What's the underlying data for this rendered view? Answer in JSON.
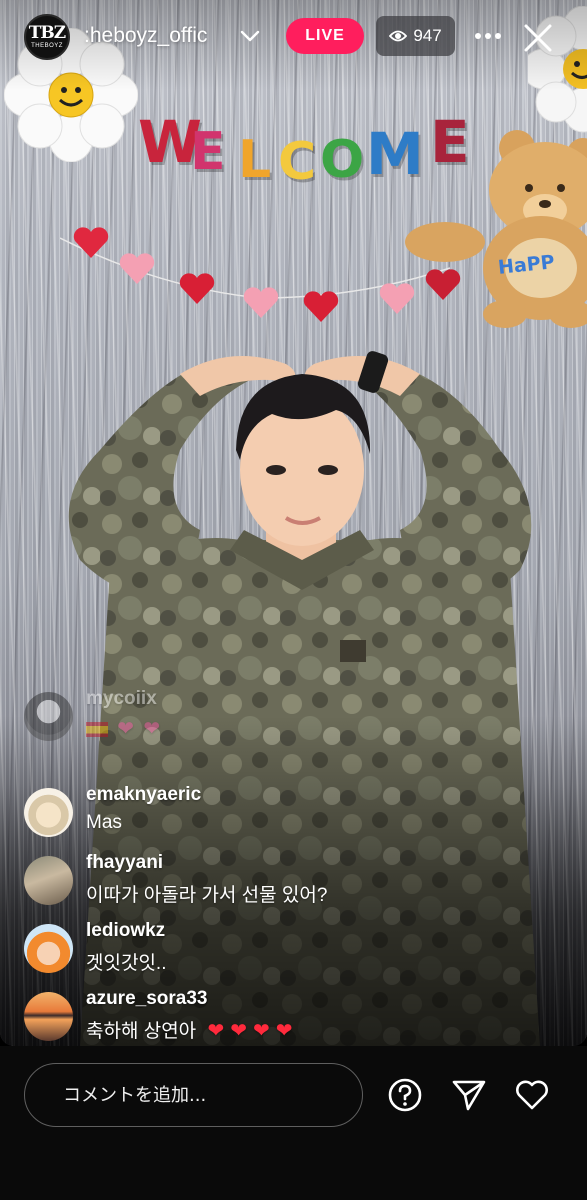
{
  "header": {
    "logo_mono": "TBZ",
    "logo_sub": "THEBOYZ",
    "username": ":heboyz_offic",
    "live_label": "LIVE",
    "viewer_count": "947"
  },
  "stage": {
    "banner_letters": [
      "W",
      "E",
      "L",
      "C",
      "O",
      "M",
      "E"
    ],
    "banner_colors": [
      "#c8243c",
      "#d1346d",
      "#f0a52b",
      "#f3c93e",
      "#3ca545",
      "#2e7cc7",
      "#a8243c"
    ],
    "balloon_text": "HaPP"
  },
  "comments": [
    {
      "user": "mycoiix",
      "message": "",
      "faded": true,
      "emoji": [
        "flag",
        "pink-heart",
        "pink-heart"
      ]
    },
    {
      "user": "emaknyaeric",
      "message": "Mas"
    },
    {
      "user": "fhayyani",
      "message": "이따가 아돌라 가서 선물 있어?"
    },
    {
      "user": "lediowkz",
      "message": "겟잇갓잇.."
    },
    {
      "user": "azure_sora33",
      "message": "축하해 상연아",
      "hearts": 4
    }
  ],
  "bottom_bar": {
    "comment_placeholder": "コメントを追加...",
    "icons": [
      "question-icon",
      "send-icon",
      "heart-icon"
    ]
  },
  "colors": {
    "live_badge": "#ff1e5d",
    "bottom_bar_bg": "#0a0a0a",
    "heart_red": "#ff2a3c"
  }
}
